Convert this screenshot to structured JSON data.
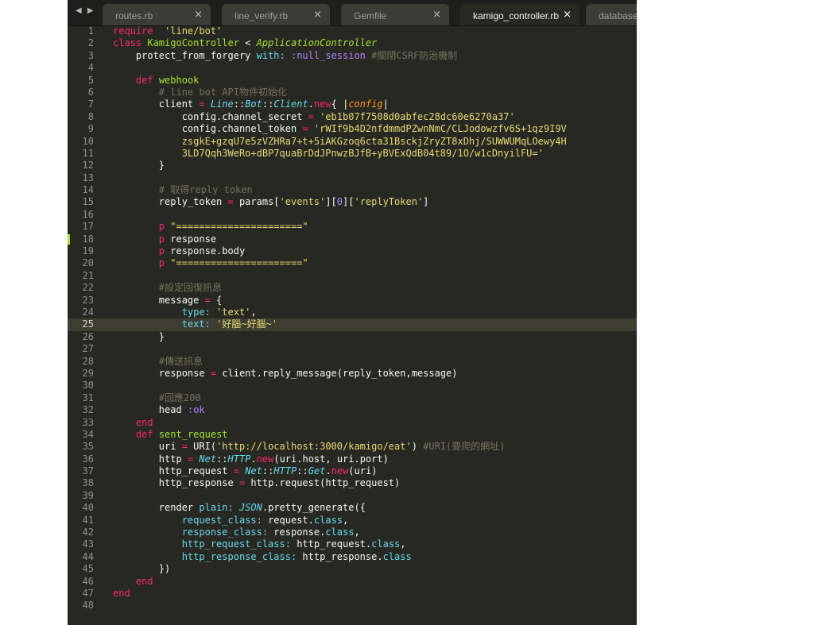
{
  "tabs": [
    {
      "label": "routes.rb",
      "active": false
    },
    {
      "label": "line_verify.rb",
      "active": false
    },
    {
      "label": "Gemfile",
      "active": false
    },
    {
      "label": "kamigo_controller.rb",
      "active": true
    },
    {
      "label": "database.y",
      "active": false
    }
  ],
  "icons": {
    "nav": "nav-arrows-icon",
    "close": "close-icon"
  },
  "colors": {
    "background": "#272822",
    "keyword": "#f92672",
    "string": "#e6db74",
    "comment": "#75715e",
    "class": "#a6e22e",
    "constant": "#66d9ef",
    "symbol": "#ae81ff"
  },
  "current_line": 25,
  "modified_line": 18,
  "code_lines": [
    [
      [
        "kw",
        "require"
      ],
      [
        "",
        "  "
      ],
      [
        "str",
        "'line/bot'"
      ]
    ],
    [
      [
        "kw",
        "class"
      ],
      [
        "",
        " "
      ],
      [
        "cls",
        "KamigoController"
      ],
      [
        "",
        " < "
      ],
      [
        "sup",
        "ApplicationController"
      ]
    ],
    [
      [
        "",
        "    protect_from_forgery "
      ],
      [
        "key",
        "with:"
      ],
      [
        "",
        " "
      ],
      [
        "sym",
        ":null_session"
      ],
      [
        "",
        " "
      ],
      [
        "cmt",
        "#關閉CSRF防治機制"
      ]
    ],
    [],
    [
      [
        "",
        "    "
      ],
      [
        "kw",
        "def"
      ],
      [
        "",
        " "
      ],
      [
        "fn",
        "webhook"
      ]
    ],
    [
      [
        "",
        "        "
      ],
      [
        "cmt",
        "# line bot API物件初始化"
      ]
    ],
    [
      [
        "",
        "        client "
      ],
      [
        "kw",
        "="
      ],
      [
        "",
        " "
      ],
      [
        "ital",
        "Line"
      ],
      [
        "",
        "::"
      ],
      [
        "ital",
        "Bot"
      ],
      [
        "",
        "::"
      ],
      [
        "ital",
        "Client"
      ],
      [
        "",
        "."
      ],
      [
        "kw",
        "new"
      ],
      [
        "",
        "{ |"
      ],
      [
        "blk",
        "config"
      ],
      [
        "",
        "|"
      ]
    ],
    [
      [
        "",
        "            config.channel_secret "
      ],
      [
        "kw",
        "="
      ],
      [
        "",
        " "
      ],
      [
        "str",
        "'eb1b07f7508d0abfec28dc60e6270a37'"
      ]
    ],
    [
      [
        "",
        "            config.channel_token "
      ],
      [
        "kw",
        "="
      ],
      [
        "",
        " "
      ],
      [
        "str",
        "'rWIf9b4D2nfdmmdPZwnNmC/CLJodowzfv6S+1qz9I9V"
      ]
    ],
    [
      [
        "str",
        "            zsgkE+gzqU7e5zVZHRa7+t+5iAKGzoq6cta31BsckjZryZT8xDhj/SUWWUMqLOewy4H"
      ]
    ],
    [
      [
        "str",
        "            3LD7Qqh3WeRo+dBP7quaBrDdJPnwzBJfB+yBVExQdB04t89/1O/w1cDnyilFU='"
      ]
    ],
    [
      [
        "",
        "        }"
      ]
    ],
    [],
    [
      [
        "",
        "        "
      ],
      [
        "cmt",
        "# 取得reply token"
      ]
    ],
    [
      [
        "",
        "        reply_token "
      ],
      [
        "kw",
        "="
      ],
      [
        "",
        " params["
      ],
      [
        "str",
        "'events'"
      ],
      [
        "",
        "]["
      ],
      [
        "num",
        "0"
      ],
      [
        "",
        "]["
      ],
      [
        "str",
        "'replyToken'"
      ],
      [
        "",
        "]"
      ]
    ],
    [],
    [
      [
        "",
        "        "
      ],
      [
        "kw",
        "p"
      ],
      [
        "",
        " "
      ],
      [
        "str",
        "\"======================\""
      ]
    ],
    [
      [
        "",
        "        "
      ],
      [
        "kw",
        "p"
      ],
      [
        "",
        " response"
      ]
    ],
    [
      [
        "",
        "        "
      ],
      [
        "kw",
        "p"
      ],
      [
        "",
        " response.body"
      ]
    ],
    [
      [
        "",
        "        "
      ],
      [
        "kw",
        "p"
      ],
      [
        "",
        " "
      ],
      [
        "str",
        "\"======================\""
      ]
    ],
    [],
    [
      [
        "",
        "        "
      ],
      [
        "cmt",
        "#設定回復訊息"
      ]
    ],
    [
      [
        "",
        "        message "
      ],
      [
        "kw",
        "="
      ],
      [
        "",
        " {"
      ]
    ],
    [
      [
        "",
        "            "
      ],
      [
        "key",
        "type:"
      ],
      [
        "",
        " "
      ],
      [
        "str",
        "'text'"
      ],
      [
        "",
        ","
      ]
    ],
    [
      [
        "",
        "            "
      ],
      [
        "key",
        "text:"
      ],
      [
        "",
        " "
      ],
      [
        "str",
        "'好腦~好腦~'"
      ]
    ],
    [
      [
        "",
        "        }"
      ]
    ],
    [],
    [
      [
        "",
        "        "
      ],
      [
        "cmt",
        "#傳送訊息"
      ]
    ],
    [
      [
        "",
        "        response "
      ],
      [
        "kw",
        "="
      ],
      [
        "",
        " client.reply_message(reply_token,message)"
      ]
    ],
    [],
    [
      [
        "",
        "        "
      ],
      [
        "cmt",
        "#回應200"
      ]
    ],
    [
      [
        "",
        "        head "
      ],
      [
        "sym",
        ":ok"
      ]
    ],
    [
      [
        "",
        "    "
      ],
      [
        "kw",
        "end"
      ]
    ],
    [
      [
        "",
        "    "
      ],
      [
        "kw",
        "def"
      ],
      [
        "",
        " "
      ],
      [
        "fn",
        "sent_request"
      ]
    ],
    [
      [
        "",
        "        uri "
      ],
      [
        "kw",
        "="
      ],
      [
        "",
        " URI("
      ],
      [
        "str",
        "'http://localhost:3000/kamigo/eat'"
      ],
      [
        "",
        ") "
      ],
      [
        "cmt",
        "#URI(要爬的網址)"
      ]
    ],
    [
      [
        "",
        "        http "
      ],
      [
        "kw",
        "="
      ],
      [
        "",
        " "
      ],
      [
        "ital",
        "Net"
      ],
      [
        "",
        "::"
      ],
      [
        "ital",
        "HTTP"
      ],
      [
        "",
        "."
      ],
      [
        "kw",
        "new"
      ],
      [
        "",
        "(uri.host, uri.port)"
      ]
    ],
    [
      [
        "",
        "        http_request "
      ],
      [
        "kw",
        "="
      ],
      [
        "",
        " "
      ],
      [
        "ital",
        "Net"
      ],
      [
        "",
        "::"
      ],
      [
        "ital",
        "HTTP"
      ],
      [
        "",
        "::"
      ],
      [
        "ital",
        "Get"
      ],
      [
        "",
        "."
      ],
      [
        "kw",
        "new"
      ],
      [
        "",
        "(uri)"
      ]
    ],
    [
      [
        "",
        "        http_response "
      ],
      [
        "kw",
        "="
      ],
      [
        "",
        " http.request(http_request)"
      ]
    ],
    [],
    [
      [
        "",
        "        render "
      ],
      [
        "key",
        "plain:"
      ],
      [
        "",
        " "
      ],
      [
        "ital",
        "JSON"
      ],
      [
        "",
        ".pretty_generate({"
      ]
    ],
    [
      [
        "",
        "            "
      ],
      [
        "key",
        "request_class:"
      ],
      [
        "",
        " request."
      ],
      [
        "blu",
        "class"
      ],
      [
        "",
        ","
      ]
    ],
    [
      [
        "",
        "            "
      ],
      [
        "key",
        "response_class:"
      ],
      [
        "",
        " response."
      ],
      [
        "blu",
        "class"
      ],
      [
        "",
        ","
      ]
    ],
    [
      [
        "",
        "            "
      ],
      [
        "key",
        "http_request_class:"
      ],
      [
        "",
        " http_request."
      ],
      [
        "blu",
        "class"
      ],
      [
        "",
        ","
      ]
    ],
    [
      [
        "",
        "            "
      ],
      [
        "key",
        "http_response_class:"
      ],
      [
        "",
        " http_response."
      ],
      [
        "blu",
        "class"
      ]
    ],
    [
      [
        "",
        "        })"
      ]
    ],
    [
      [
        "",
        "    "
      ],
      [
        "kw",
        "end"
      ]
    ],
    [
      [
        "kw",
        "end"
      ]
    ],
    []
  ]
}
